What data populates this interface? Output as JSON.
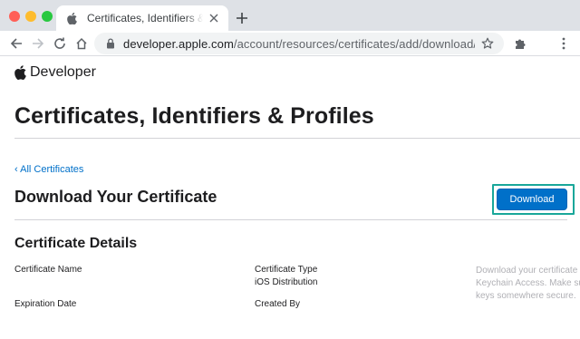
{
  "browser": {
    "tab": {
      "title": "Certificates, Identifiers & Profiles"
    },
    "address": {
      "host": "developer.apple.com",
      "path": "/account/resources/certificates/add/download/ZNX…"
    }
  },
  "page": {
    "brand": "Developer",
    "title": "Certificates, Identifiers & Profiles",
    "back_link": "‹ All Certificates",
    "section_title": "Download Your Certificate",
    "download_label": "Download",
    "details_title": "Certificate Details",
    "fields": {
      "certificate_name_label": "Certificate Name",
      "certificate_type_label": "Certificate Type",
      "certificate_type_value": "iOS Distribution",
      "expiration_date_label": "Expiration Date",
      "created_by_label": "Created By"
    },
    "help_lines": [
      "Download your certificate to",
      "Keychain Access. Make sure to",
      "keys somewhere secure."
    ]
  },
  "colors": {
    "link": "#0070c9",
    "button": "#0070c9",
    "highlight": "#19a79a"
  }
}
